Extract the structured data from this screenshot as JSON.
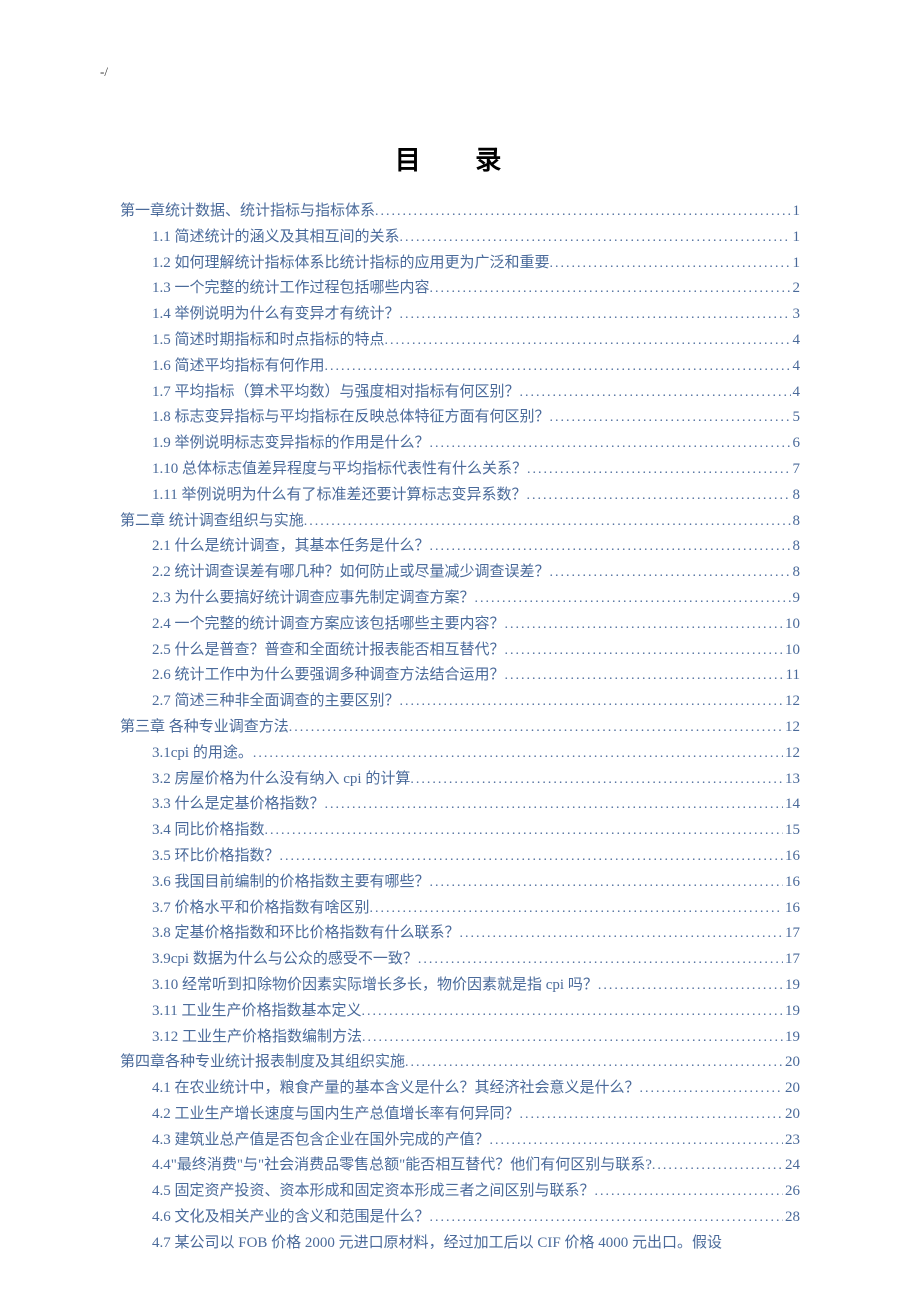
{
  "header_mark": "-/",
  "title": "目  录",
  "toc": [
    {
      "level": 0,
      "label": "第一章统计数据、统计指标与指标体系",
      "page": "1"
    },
    {
      "level": 1,
      "label": "1.1 简述统计的涵义及其相互间的关系",
      "page": "1"
    },
    {
      "level": 1,
      "label": "1.2 如何理解统计指标体系比统计指标的应用更为广泛和重要",
      "page": "1"
    },
    {
      "level": 1,
      "label": "1.3 一个完整的统计工作过程包括哪些内容",
      "page": "2"
    },
    {
      "level": 1,
      "label": "1.4 举例说明为什么有变异才有统计？",
      "page": "3"
    },
    {
      "level": 1,
      "label": "1.5 简述时期指标和时点指标的特点",
      "page": "4"
    },
    {
      "level": 1,
      "label": "1.6 简述平均指标有何作用",
      "page": "4"
    },
    {
      "level": 1,
      "label": "1.7 平均指标（算术平均数）与强度相对指标有何区别？",
      "page": "4"
    },
    {
      "level": 1,
      "label": "1.8 标志变异指标与平均指标在反映总体特征方面有何区别？",
      "page": "5"
    },
    {
      "level": 1,
      "label": "1.9 举例说明标志变异指标的作用是什么？",
      "page": "6"
    },
    {
      "level": 1,
      "label": "1.10 总体标志值差异程度与平均指标代表性有什么关系？",
      "page": "7"
    },
    {
      "level": 1,
      "label": "1.11 举例说明为什么有了标准差还要计算标志变异系数？",
      "page": "8"
    },
    {
      "level": 0,
      "label": "第二章  统计调查组织与实施",
      "page": "8"
    },
    {
      "level": 1,
      "label": "2.1 什么是统计调查，其基本任务是什么？",
      "page": "8"
    },
    {
      "level": 1,
      "label": "2.2 统计调查误差有哪几种？如何防止或尽量减少调查误差？",
      "page": "8"
    },
    {
      "level": 1,
      "label": "2.3 为什么要搞好统计调查应事先制定调查方案？",
      "page": "9"
    },
    {
      "level": 1,
      "label": "2.4 一个完整的统计调查方案应该包括哪些主要内容？",
      "page": "10"
    },
    {
      "level": 1,
      "label": "2.5 什么是普查？普查和全面统计报表能否相互替代？",
      "page": "10"
    },
    {
      "level": 1,
      "label": "2.6 统计工作中为什么要强调多种调查方法结合运用？",
      "page": "11"
    },
    {
      "level": 1,
      "label": "2.7 简述三种非全面调查的主要区别？",
      "page": "12"
    },
    {
      "level": 0,
      "label": "第三章  各种专业调查方法",
      "page": "12"
    },
    {
      "level": 1,
      "label": "3.1cpi 的用途。",
      "page": "12"
    },
    {
      "level": 1,
      "label": "3.2  房屋价格为什么没有纳入 cpi 的计算",
      "page": "13"
    },
    {
      "level": 1,
      "label": "3.3  什么是定基价格指数？",
      "page": "14"
    },
    {
      "level": 1,
      "label": "3.4 同比价格指数",
      "page": "15"
    },
    {
      "level": 1,
      "label": "3.5 环比价格指数？",
      "page": "16"
    },
    {
      "level": 1,
      "label": "3.6  我国目前编制的价格指数主要有哪些？",
      "page": "16"
    },
    {
      "level": 1,
      "label": "3.7  价格水平和价格指数有啥区别",
      "page": "16"
    },
    {
      "level": 1,
      "label": "3.8 定基价格指数和环比价格指数有什么联系？",
      "page": "17"
    },
    {
      "level": 1,
      "label": "3.9cpi 数据为什么与公众的感受不一致？",
      "page": "17"
    },
    {
      "level": 1,
      "label": "3.10 经常听到扣除物价因素实际增长多长，物价因素就是指 cpi 吗？",
      "page": "19"
    },
    {
      "level": 1,
      "label": "3.11 工业生产价格指数基本定义",
      "page": "19"
    },
    {
      "level": 1,
      "label": "3.12 工业生产价格指数编制方法",
      "page": "19"
    },
    {
      "level": 0,
      "label": "第四章各种专业统计报表制度及其组织实施",
      "page": "20"
    },
    {
      "level": 1,
      "label": "4.1 在农业统计中，粮食产量的基本含义是什么？其经济社会意义是什么？",
      "page": "20"
    },
    {
      "level": 1,
      "label": "4.2 工业生产增长速度与国内生产总值增长率有何异同？",
      "page": "20"
    },
    {
      "level": 1,
      "label": "4.3 建筑业总产值是否包含企业在国外完成的产值？",
      "page": "23"
    },
    {
      "level": 1,
      "label": "4.4\"最终消费\"与\"社会消费品零售总额\"能否相互替代？他们有何区别与联系?",
      "page": "24"
    },
    {
      "level": 1,
      "label": "4.5 固定资产投资、资本形成和固定资本形成三者之间区别与联系？",
      "page": "26"
    },
    {
      "level": 1,
      "label": "4.6 文化及相关产业的含义和范围是什么？",
      "page": "28"
    },
    {
      "level": 1,
      "label": "4.7 某公司以 FOB 价格 2000 元进口原材料，经过加工后以 CIF 价格 4000 元出口。假设",
      "page": "",
      "nodots": true
    }
  ]
}
